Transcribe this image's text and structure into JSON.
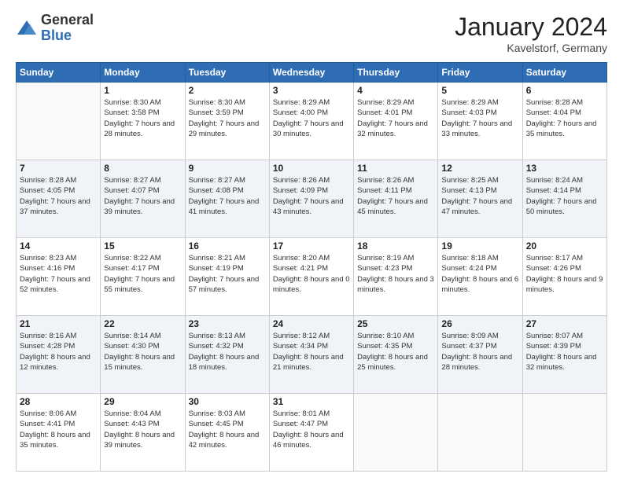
{
  "header": {
    "logo": {
      "general": "General",
      "blue": "Blue"
    },
    "title": "January 2024",
    "location": "Kavelstorf, Germany"
  },
  "weekdays": [
    "Sunday",
    "Monday",
    "Tuesday",
    "Wednesday",
    "Thursday",
    "Friday",
    "Saturday"
  ],
  "weeks": [
    [
      {
        "day": "",
        "sunrise": "",
        "sunset": "",
        "daylight": ""
      },
      {
        "day": "1",
        "sunrise": "Sunrise: 8:30 AM",
        "sunset": "Sunset: 3:58 PM",
        "daylight": "Daylight: 7 hours and 28 minutes."
      },
      {
        "day": "2",
        "sunrise": "Sunrise: 8:30 AM",
        "sunset": "Sunset: 3:59 PM",
        "daylight": "Daylight: 7 hours and 29 minutes."
      },
      {
        "day": "3",
        "sunrise": "Sunrise: 8:29 AM",
        "sunset": "Sunset: 4:00 PM",
        "daylight": "Daylight: 7 hours and 30 minutes."
      },
      {
        "day": "4",
        "sunrise": "Sunrise: 8:29 AM",
        "sunset": "Sunset: 4:01 PM",
        "daylight": "Daylight: 7 hours and 32 minutes."
      },
      {
        "day": "5",
        "sunrise": "Sunrise: 8:29 AM",
        "sunset": "Sunset: 4:03 PM",
        "daylight": "Daylight: 7 hours and 33 minutes."
      },
      {
        "day": "6",
        "sunrise": "Sunrise: 8:28 AM",
        "sunset": "Sunset: 4:04 PM",
        "daylight": "Daylight: 7 hours and 35 minutes."
      }
    ],
    [
      {
        "day": "7",
        "sunrise": "Sunrise: 8:28 AM",
        "sunset": "Sunset: 4:05 PM",
        "daylight": "Daylight: 7 hours and 37 minutes."
      },
      {
        "day": "8",
        "sunrise": "Sunrise: 8:27 AM",
        "sunset": "Sunset: 4:07 PM",
        "daylight": "Daylight: 7 hours and 39 minutes."
      },
      {
        "day": "9",
        "sunrise": "Sunrise: 8:27 AM",
        "sunset": "Sunset: 4:08 PM",
        "daylight": "Daylight: 7 hours and 41 minutes."
      },
      {
        "day": "10",
        "sunrise": "Sunrise: 8:26 AM",
        "sunset": "Sunset: 4:09 PM",
        "daylight": "Daylight: 7 hours and 43 minutes."
      },
      {
        "day": "11",
        "sunrise": "Sunrise: 8:26 AM",
        "sunset": "Sunset: 4:11 PM",
        "daylight": "Daylight: 7 hours and 45 minutes."
      },
      {
        "day": "12",
        "sunrise": "Sunrise: 8:25 AM",
        "sunset": "Sunset: 4:13 PM",
        "daylight": "Daylight: 7 hours and 47 minutes."
      },
      {
        "day": "13",
        "sunrise": "Sunrise: 8:24 AM",
        "sunset": "Sunset: 4:14 PM",
        "daylight": "Daylight: 7 hours and 50 minutes."
      }
    ],
    [
      {
        "day": "14",
        "sunrise": "Sunrise: 8:23 AM",
        "sunset": "Sunset: 4:16 PM",
        "daylight": "Daylight: 7 hours and 52 minutes."
      },
      {
        "day": "15",
        "sunrise": "Sunrise: 8:22 AM",
        "sunset": "Sunset: 4:17 PM",
        "daylight": "Daylight: 7 hours and 55 minutes."
      },
      {
        "day": "16",
        "sunrise": "Sunrise: 8:21 AM",
        "sunset": "Sunset: 4:19 PM",
        "daylight": "Daylight: 7 hours and 57 minutes."
      },
      {
        "day": "17",
        "sunrise": "Sunrise: 8:20 AM",
        "sunset": "Sunset: 4:21 PM",
        "daylight": "Daylight: 8 hours and 0 minutes."
      },
      {
        "day": "18",
        "sunrise": "Sunrise: 8:19 AM",
        "sunset": "Sunset: 4:23 PM",
        "daylight": "Daylight: 8 hours and 3 minutes."
      },
      {
        "day": "19",
        "sunrise": "Sunrise: 8:18 AM",
        "sunset": "Sunset: 4:24 PM",
        "daylight": "Daylight: 8 hours and 6 minutes."
      },
      {
        "day": "20",
        "sunrise": "Sunrise: 8:17 AM",
        "sunset": "Sunset: 4:26 PM",
        "daylight": "Daylight: 8 hours and 9 minutes."
      }
    ],
    [
      {
        "day": "21",
        "sunrise": "Sunrise: 8:16 AM",
        "sunset": "Sunset: 4:28 PM",
        "daylight": "Daylight: 8 hours and 12 minutes."
      },
      {
        "day": "22",
        "sunrise": "Sunrise: 8:14 AM",
        "sunset": "Sunset: 4:30 PM",
        "daylight": "Daylight: 8 hours and 15 minutes."
      },
      {
        "day": "23",
        "sunrise": "Sunrise: 8:13 AM",
        "sunset": "Sunset: 4:32 PM",
        "daylight": "Daylight: 8 hours and 18 minutes."
      },
      {
        "day": "24",
        "sunrise": "Sunrise: 8:12 AM",
        "sunset": "Sunset: 4:34 PM",
        "daylight": "Daylight: 8 hours and 21 minutes."
      },
      {
        "day": "25",
        "sunrise": "Sunrise: 8:10 AM",
        "sunset": "Sunset: 4:35 PM",
        "daylight": "Daylight: 8 hours and 25 minutes."
      },
      {
        "day": "26",
        "sunrise": "Sunrise: 8:09 AM",
        "sunset": "Sunset: 4:37 PM",
        "daylight": "Daylight: 8 hours and 28 minutes."
      },
      {
        "day": "27",
        "sunrise": "Sunrise: 8:07 AM",
        "sunset": "Sunset: 4:39 PM",
        "daylight": "Daylight: 8 hours and 32 minutes."
      }
    ],
    [
      {
        "day": "28",
        "sunrise": "Sunrise: 8:06 AM",
        "sunset": "Sunset: 4:41 PM",
        "daylight": "Daylight: 8 hours and 35 minutes."
      },
      {
        "day": "29",
        "sunrise": "Sunrise: 8:04 AM",
        "sunset": "Sunset: 4:43 PM",
        "daylight": "Daylight: 8 hours and 39 minutes."
      },
      {
        "day": "30",
        "sunrise": "Sunrise: 8:03 AM",
        "sunset": "Sunset: 4:45 PM",
        "daylight": "Daylight: 8 hours and 42 minutes."
      },
      {
        "day": "31",
        "sunrise": "Sunrise: 8:01 AM",
        "sunset": "Sunset: 4:47 PM",
        "daylight": "Daylight: 8 hours and 46 minutes."
      },
      {
        "day": "",
        "sunrise": "",
        "sunset": "",
        "daylight": ""
      },
      {
        "day": "",
        "sunrise": "",
        "sunset": "",
        "daylight": ""
      },
      {
        "day": "",
        "sunrise": "",
        "sunset": "",
        "daylight": ""
      }
    ]
  ]
}
